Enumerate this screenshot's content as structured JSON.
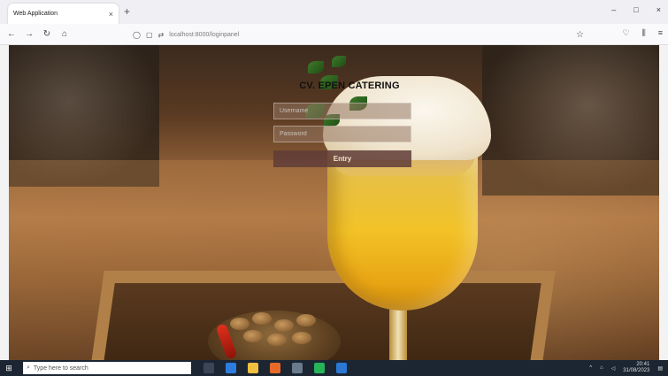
{
  "browser": {
    "tab_title": "Web Application",
    "tab_close": "×",
    "new_tab": "+",
    "url": "localhost:8000/loginpanel",
    "window_minimize": "–",
    "window_maximize": "□",
    "window_close": "×"
  },
  "login": {
    "brand": "CV. EPEN CATERING",
    "username_placeholder": "Username",
    "password_placeholder": "Password",
    "submit_label": "Entry"
  },
  "taskbar": {
    "search_placeholder": "Type here to search",
    "time": "20:41",
    "date": "31/08/2023"
  },
  "colors": {
    "taskbar_bg": "#1c2633",
    "entry_button": "#5f3c37",
    "brand_text": "#111111"
  }
}
